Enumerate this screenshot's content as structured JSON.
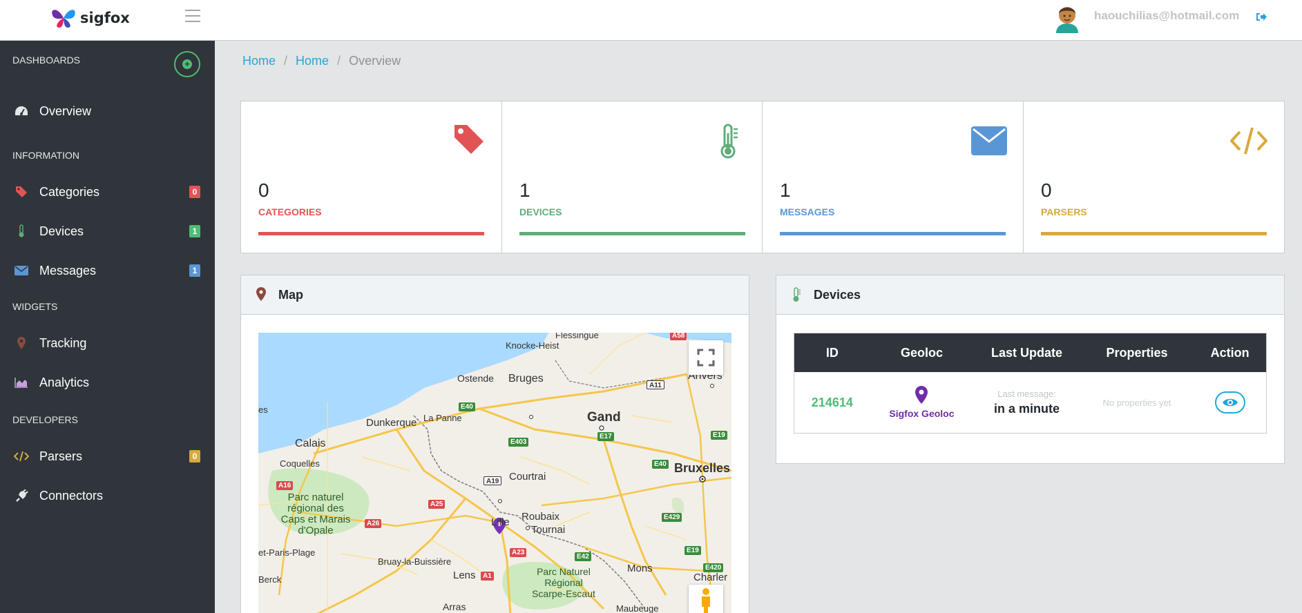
{
  "header": {
    "logo_text": "sigfox",
    "user_email": "haouchilias@hotmail.com"
  },
  "sidebar": {
    "sections": [
      {
        "title": "DASHBOARDS"
      },
      {
        "title": "INFORMATION"
      },
      {
        "title": "WIDGETS"
      },
      {
        "title": "DEVELOPERS"
      }
    ],
    "items": [
      {
        "label": "Overview",
        "icon": "dashboard-icon"
      },
      {
        "label": "Categories",
        "icon": "tag-icon",
        "badge": "0",
        "badge_color": "#e25454"
      },
      {
        "label": "Devices",
        "icon": "thermometer-icon",
        "badge": "1",
        "badge_color": "#4dbd74"
      },
      {
        "label": "Messages",
        "icon": "envelope-icon",
        "badge": "1",
        "badge_color": "#5a96d6"
      },
      {
        "label": "Tracking",
        "icon": "map-marker-icon"
      },
      {
        "label": "Analytics",
        "icon": "area-chart-icon"
      },
      {
        "label": "Parsers",
        "icon": "code-icon",
        "badge": "0",
        "badge_color": "#d9a93d"
      },
      {
        "label": "Connectors",
        "icon": "plug-icon"
      }
    ]
  },
  "breadcrumb": {
    "items": [
      "Home",
      "Home"
    ],
    "active": "Overview"
  },
  "stats": [
    {
      "value": "0",
      "label": "CATEGORIES",
      "color": "#e25454",
      "icon": "tag-icon"
    },
    {
      "value": "1",
      "label": "DEVICES",
      "color": "#5fac7a",
      "icon": "thermometer-icon"
    },
    {
      "value": "1",
      "label": "MESSAGES",
      "color": "#5a96d6",
      "icon": "envelope-icon"
    },
    {
      "value": "0",
      "label": "PARSERS",
      "color": "#d9a93d",
      "icon": "code-icon"
    }
  ],
  "map_panel": {
    "title": "Map",
    "places": [
      "Flessingue",
      "Knocke-Heist",
      "Ostende",
      "Bruges",
      "Anvers",
      "es",
      "Dunkerque",
      "La Panne",
      "Gand",
      "Calais",
      "Coquelles",
      "Courtrai",
      "Bruxelles",
      "Parc naturel régional des Caps et Marais d'Opale",
      "Lille",
      "Roubaix",
      "Tournai",
      "et-Paris-Plage",
      "Bruay-la-Buissière",
      "Berck",
      "Lens",
      "Parc Naturel Régional Scarpe-Escaut",
      "Mons",
      "Charler",
      "Arras",
      "Maubeuge"
    ],
    "roads": [
      "A58",
      "A11",
      "E40",
      "E17",
      "E403",
      "E19",
      "A19",
      "E40",
      "A16",
      "A25",
      "A26",
      "A23",
      "E42",
      "E429",
      "E19",
      "E420",
      "A1"
    ]
  },
  "devices_panel": {
    "title": "Devices",
    "columns": [
      "ID",
      "Geoloc",
      "Last Update",
      "Properties",
      "Action"
    ],
    "rows": [
      {
        "id": "214614",
        "geoloc": "Sigfox Geoloc",
        "last_message_label": "Last message:",
        "last_update": "in a minute",
        "properties": "No properties yet"
      }
    ]
  }
}
